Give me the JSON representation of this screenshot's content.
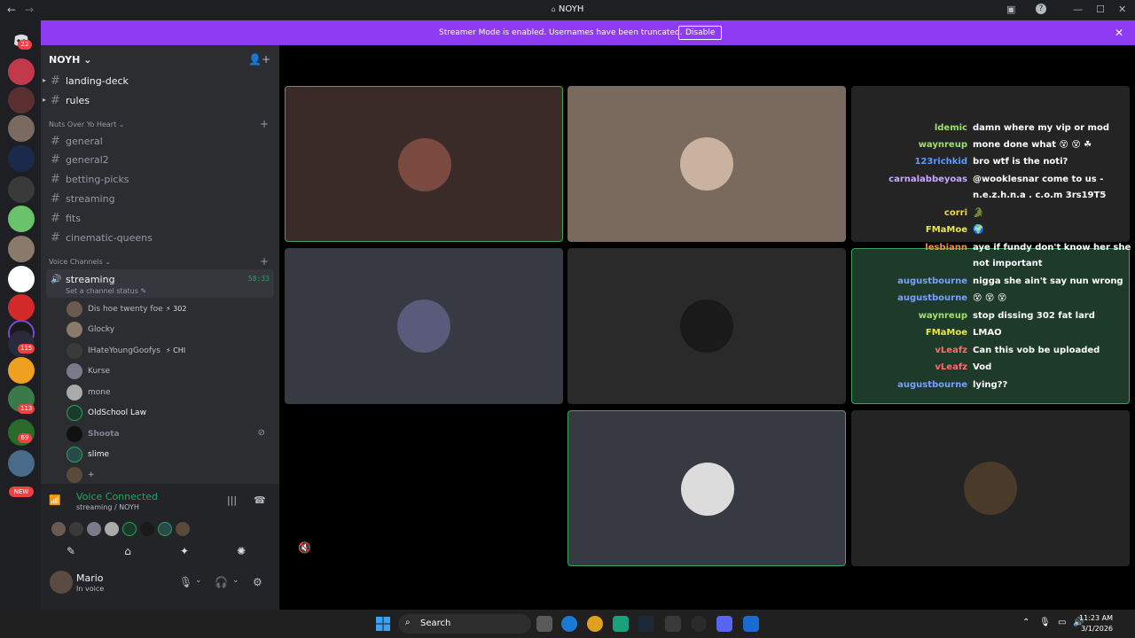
{
  "window": {
    "title": "NOYH",
    "back_glyph": "←",
    "forward_glyph": "→",
    "title_icon": "⌂",
    "inbox_glyph": "▣",
    "help_glyph": "?",
    "minimize_glyph": "—",
    "maximize_glyph": "☐",
    "close_glyph": "✕"
  },
  "banner": {
    "message": "Streamer Mode is enabled. Usernames have been truncated.",
    "button": "Disable",
    "close_glyph": "✕",
    "color": "#8f3bf3"
  },
  "server_rail": {
    "home_badge": "22",
    "badges": [
      "115",
      "113",
      "69"
    ],
    "new_label": "NEW"
  },
  "guild": {
    "name": "NOYH",
    "caret": "⌄",
    "invite_icon": "👤+"
  },
  "channels_top": [
    {
      "name": "landing-deck",
      "caret": "▸"
    },
    {
      "name": "rules",
      "caret": "▸"
    }
  ],
  "category_1": {
    "name": "Nuts Over Yo Heart ⌄",
    "add": "+"
  },
  "channels_cat1": [
    {
      "name": "general"
    },
    {
      "name": "general2"
    },
    {
      "name": "betting-picks"
    },
    {
      "name": "streaming"
    },
    {
      "name": "fits"
    },
    {
      "name": "cinematic-queens"
    }
  ],
  "category_2": {
    "name": "Voice Channels ⌄",
    "add": "+"
  },
  "voice_channel": {
    "name": "streaming",
    "speaker_glyph": "🔊",
    "timer": "58:33",
    "status": "Set a channel status ✎"
  },
  "voice_users": [
    {
      "name": "Dis hoe twenty foe",
      "tag": "⚡ 302"
    },
    {
      "name": "Glocky",
      "tag": ""
    },
    {
      "name": "IHateYoungGoofys",
      "tag": "⚡ CHI"
    },
    {
      "name": "Kurse",
      "tag": ""
    },
    {
      "name": "mone",
      "tag": ""
    },
    {
      "name": "OldSchool Law",
      "tag": ""
    },
    {
      "name": "Shoota",
      "tag": ""
    },
    {
      "name": "slime",
      "tag": ""
    },
    {
      "name": "+",
      "tag": ""
    }
  ],
  "voice_panel": {
    "title": "Voice Connected",
    "subtitle": "streaming / NOYH",
    "signal_glyph": "📶",
    "bars_glyph": "|||",
    "hangup_glyph": "☎",
    "actions": [
      "✎",
      "⌂",
      "✦",
      "✺"
    ]
  },
  "user": {
    "name": "Mario",
    "status": "In voice",
    "mic_glyph": "🎙",
    "headset_glyph": "🎧",
    "settings_glyph": "⚙",
    "chevron": "⌄"
  },
  "stage": {
    "muted_glyph": "🔇"
  },
  "chat": [
    {
      "who": "waynreup",
      "msg": "mone done what 😵 😵 ☘",
      "color": "#9fe26a"
    },
    {
      "who": "123richkid",
      "msg": "bro wtf is the noti?",
      "color": "#5b9cff"
    },
    {
      "who": "carnalabbeyoas",
      "msg": "@wooklesnar come to us -",
      "color": "#c9a8ff"
    },
    {
      "who": "",
      "msg": "n.e.z.h.n.a . c.o.m 3rs19T5",
      "color": "#ffffff"
    },
    {
      "who": "corri",
      "msg": "🐊",
      "color": "#f0d64a"
    },
    {
      "who": "FMaMoe",
      "msg": "🌍",
      "color": "#e8e84a"
    },
    {
      "who": "lesbiann",
      "msg": "aye if fundy don't know her she",
      "color": "#ff8a3c"
    },
    {
      "who": "",
      "msg": "not important",
      "color": "#ffffff"
    },
    {
      "who": "augustbourne",
      "msg": "nigga she ain't say nun wrong",
      "color": "#7aa0ff"
    },
    {
      "who": "augustbourne",
      "msg": "😵 😵 😵",
      "color": "#7aa0ff"
    },
    {
      "who": "waynreup",
      "msg": "stop dissing 302 fat lard",
      "color": "#9fe26a"
    },
    {
      "who": "FMaMoe",
      "msg": "LMAO",
      "color": "#e8e84a"
    },
    {
      "who": "vLeafz",
      "msg": "Can this vob be uploaded",
      "color": "#ff6b6b"
    },
    {
      "who": "vLeafz",
      "msg": "Vod",
      "color": "#ff6b6b"
    },
    {
      "who": "augustbourne",
      "msg": "lying??",
      "color": "#7aa0ff"
    }
  ],
  "chat_top_partial": {
    "who": "ldemic",
    "msg": "damn where my vip or mod",
    "color": "#9fe26a"
  },
  "taskbar": {
    "search": "Search",
    "search_glyph": "⌕",
    "time": "11:23 AM",
    "date": "3/1/2026",
    "tray": [
      "⌃",
      "🎙",
      "▭",
      "🔊"
    ]
  }
}
